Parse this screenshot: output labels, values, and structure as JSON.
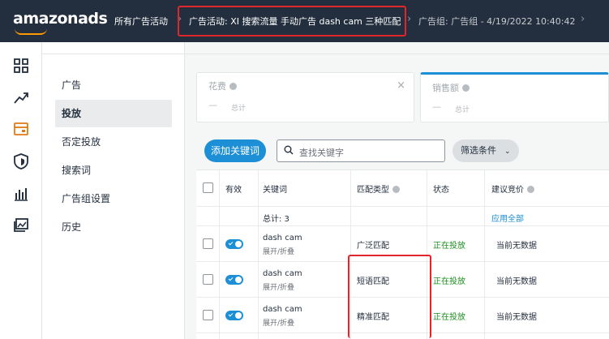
{
  "topbar": {
    "logo": "amazonads",
    "breadcrumb": [
      {
        "label": "所有广告活动"
      },
      {
        "label": "广告活动: XI 搜索流量 手动广告 dash cam 三种匹配"
      },
      {
        "label": "广告组: 广告组 - 4/19/2022 10:40:42"
      }
    ]
  },
  "rail": {
    "icons": [
      "dashboard-icon",
      "trend-icon",
      "campaign-icon",
      "shield-icon",
      "bar-chart-icon",
      "image-icon"
    ]
  },
  "subnav": {
    "items": [
      {
        "label": "广告"
      },
      {
        "label": "投放"
      },
      {
        "label": "否定投放"
      },
      {
        "label": "搜索词"
      },
      {
        "label": "广告组设置"
      },
      {
        "label": "历史"
      }
    ],
    "active_index": 1
  },
  "metrics": [
    {
      "label": "花费",
      "value": "—",
      "sub": "总计"
    },
    {
      "label": "销售额",
      "value": "—",
      "sub": "总计"
    }
  ],
  "toolbar": {
    "add_label": "添加关键词",
    "search_placeholder": "查找关键字",
    "filter_label": "筛选条件"
  },
  "table": {
    "headers": {
      "active": "有效",
      "keyword": "关键词",
      "match_type": "匹配类型",
      "status": "状态",
      "suggested_bid": "建议竞价"
    },
    "summary": {
      "total": "总计: 3",
      "apply_all": "应用全部"
    },
    "rows": [
      {
        "keyword": "dash cam",
        "keyword_sub": "展开/折叠",
        "match_type": "广泛匹配",
        "status": "正在投放",
        "bid": "当前无数据",
        "enabled": true
      },
      {
        "keyword": "dash cam",
        "keyword_sub": "展开/折叠",
        "match_type": "短语匹配",
        "status": "正在投放",
        "bid": "当前无数据",
        "enabled": true
      },
      {
        "keyword": "dash cam",
        "keyword_sub": "展开/折叠",
        "match_type": "精准匹配",
        "status": "正在投放",
        "bid": "当前无数据",
        "enabled": true
      }
    ]
  },
  "colors": {
    "topbar": "#232f3e",
    "accent": "#1c8fd6",
    "brand_orange": "#ff9900",
    "status_green": "#1e8e1e",
    "highlight_red": "#e0262a"
  }
}
